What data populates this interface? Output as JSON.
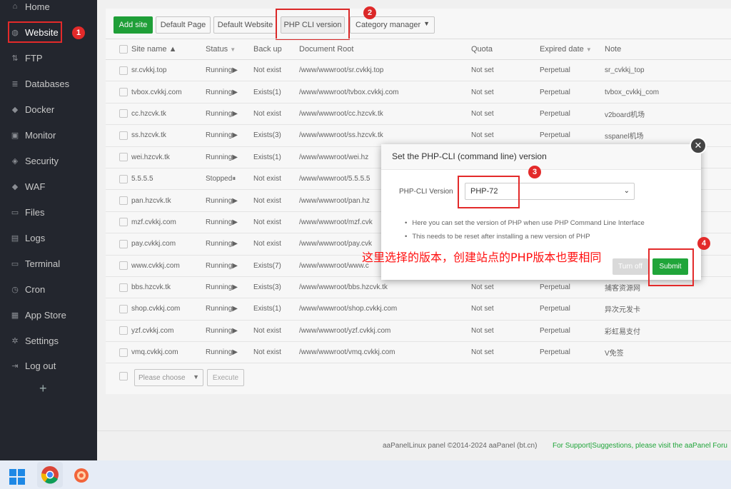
{
  "sidebar": {
    "items": [
      {
        "label": "Home",
        "icon": "home-icon",
        "glyph": "⌂"
      },
      {
        "label": "Website",
        "icon": "globe-icon",
        "glyph": "◍"
      },
      {
        "label": "FTP",
        "icon": "ftp-icon",
        "glyph": "⇅"
      },
      {
        "label": "Databases",
        "icon": "database-icon",
        "glyph": "≣"
      },
      {
        "label": "Docker",
        "icon": "docker-icon",
        "glyph": "◆"
      },
      {
        "label": "Monitor",
        "icon": "monitor-icon",
        "glyph": "▣"
      },
      {
        "label": "Security",
        "icon": "shield-icon",
        "glyph": "◈"
      },
      {
        "label": "WAF",
        "icon": "waf-icon",
        "glyph": "◆"
      },
      {
        "label": "Files",
        "icon": "folder-icon",
        "glyph": "▭"
      },
      {
        "label": "Logs",
        "icon": "logs-icon",
        "glyph": "▤"
      },
      {
        "label": "Terminal",
        "icon": "terminal-icon",
        "glyph": "▭"
      },
      {
        "label": "Cron",
        "icon": "cron-icon",
        "glyph": "◷"
      },
      {
        "label": "App Store",
        "icon": "appstore-icon",
        "glyph": "▦"
      },
      {
        "label": "Settings",
        "icon": "gear-icon",
        "glyph": "✲"
      },
      {
        "label": "Log out",
        "icon": "logout-icon",
        "glyph": "⇥"
      }
    ],
    "plus": "+"
  },
  "toolbar": {
    "add_site": "Add site",
    "default_page": "Default Page",
    "default_website": "Default Website",
    "php_cli": "PHP CLI version",
    "category": "Category manager"
  },
  "badges": {
    "b1": "1",
    "b2": "2",
    "b3": "3",
    "b4": "4"
  },
  "table": {
    "headers": {
      "site": "Site name ▲",
      "status": "Status",
      "backup": "Back up",
      "root": "Document Root",
      "quota": "Quota",
      "expired": "Expired date",
      "note": "Note"
    },
    "rows": [
      {
        "site": "sr.cvkkj.top",
        "status": "Running▶",
        "backup": "Not exist",
        "root": "/www/wwwroot/sr.cvkkj.top",
        "quota": "Not set",
        "expired": "Perpetual",
        "note": "sr_cvkkj_top"
      },
      {
        "site": "tvbox.cvkkj.com",
        "status": "Running▶",
        "backup": "Exists(1)",
        "root": "/www/wwwroot/tvbox.cvkkj.com",
        "quota": "Not set",
        "expired": "Perpetual",
        "note": "tvbox_cvkkj_com"
      },
      {
        "site": "cc.hzcvk.tk",
        "status": "Running▶",
        "backup": "Not exist",
        "root": "/www/wwwroot/cc.hzcvk.tk",
        "quota": "Not set",
        "expired": "Perpetual",
        "note": "v2board机场"
      },
      {
        "site": "ss.hzcvk.tk",
        "status": "Running▶",
        "backup": "Exists(3)",
        "root": "/www/wwwroot/ss.hzcvk.tk",
        "quota": "Not set",
        "expired": "Perpetual",
        "note": "sspanel机场"
      },
      {
        "site": "wei.hzcvk.tk",
        "status": "Running▶",
        "backup": "Exists(1)",
        "root": "/www/wwwroot/wei.hz",
        "quota": "",
        "expired": "",
        "note": ""
      },
      {
        "site": "5.5.5.5",
        "status": "Stopped⏸",
        "backup": "Not exist",
        "root": "/www/wwwroot/5.5.5.5",
        "quota": "",
        "expired": "",
        "note": ""
      },
      {
        "site": "pan.hzcvk.tk",
        "status": "Running▶",
        "backup": "Not exist",
        "root": "/www/wwwroot/pan.hz",
        "quota": "",
        "expired": "",
        "note": ""
      },
      {
        "site": "mzf.cvkkj.com",
        "status": "Running▶",
        "backup": "Not exist",
        "root": "/www/wwwroot/mzf.cvk",
        "quota": "",
        "expired": "",
        "note": ""
      },
      {
        "site": "pay.cvkkj.com",
        "status": "Running▶",
        "backup": "Not exist",
        "root": "/www/wwwroot/pay.cvk",
        "quota": "",
        "expired": "",
        "note": ""
      },
      {
        "site": "www.cvkkj.com",
        "status": "Running▶",
        "backup": "Exists(7)",
        "root": "/www/wwwroot/www.c",
        "quota": "",
        "expired": "",
        "note": ""
      },
      {
        "site": "bbs.hzcvk.tk",
        "status": "Running▶",
        "backup": "Exists(3)",
        "root": "/www/wwwroot/bbs.hzcvk.tk",
        "quota": "Not set",
        "expired": "Perpetual",
        "note": "捕客资源网"
      },
      {
        "site": "shop.cvkkj.com",
        "status": "Running▶",
        "backup": "Exists(1)",
        "root": "/www/wwwroot/shop.cvkkj.com",
        "quota": "Not set",
        "expired": "Perpetual",
        "note": "异次元发卡"
      },
      {
        "site": "yzf.cvkkj.com",
        "status": "Running▶",
        "backup": "Not exist",
        "root": "/www/wwwroot/yzf.cvkkj.com",
        "quota": "Not set",
        "expired": "Perpetual",
        "note": "彩虹易支付"
      },
      {
        "site": "vmq.cvkkj.com",
        "status": "Running▶",
        "backup": "Not exist",
        "root": "/www/wwwroot/vmq.cvkkj.com",
        "quota": "Not set",
        "expired": "Perpetual",
        "note": "V免签"
      }
    ]
  },
  "bottom": {
    "choose": "Please choose",
    "execute": "Execute"
  },
  "footer": {
    "copyright": "aaPanelLinux panel ©2014-2024 aaPanel (bt.cn)",
    "support": "For Support|Suggestions, please visit the aaPanel Foru"
  },
  "modal": {
    "title": "Set the PHP-CLI (command line) version",
    "close": "✕",
    "field_label": "PHP-CLI Version",
    "selected": "PHP-72",
    "tip1": "Here you can set the version of PHP when use PHP Command Line Interface",
    "tip2": "This needs to be reset after installing a new version of PHP",
    "turn_off": "Turn off",
    "submit": "Submit"
  },
  "annotation": "这里选择的版本，创建站点的PHP版本也要相同",
  "colors": {
    "green": "#20a53a",
    "red": "#e32a2a",
    "sidebar": "#23262e"
  }
}
